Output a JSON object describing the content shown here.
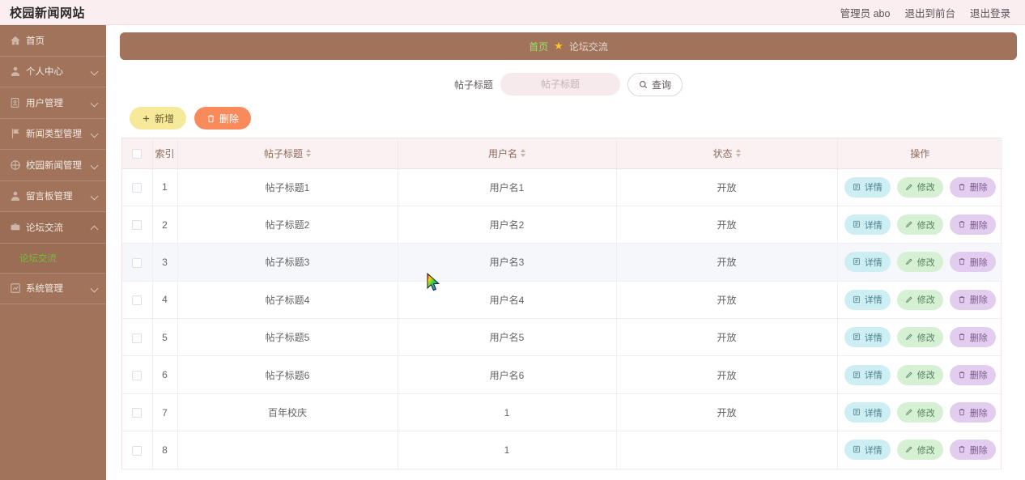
{
  "header": {
    "brand": "校园新闻网站",
    "admin_label": "管理员 abo",
    "exit_front_label": "退出到前台",
    "logout_label": "退出登录"
  },
  "sidebar": {
    "items": [
      {
        "label": "首页",
        "icon": "home-icon",
        "has_arrow": false,
        "expanded": false
      },
      {
        "label": "个人中心",
        "icon": "user-icon",
        "has_arrow": true,
        "expanded": false
      },
      {
        "label": "用户管理",
        "icon": "id-card-icon",
        "has_arrow": true,
        "expanded": false
      },
      {
        "label": "新闻类型管理",
        "icon": "flag-icon",
        "has_arrow": true,
        "expanded": false
      },
      {
        "label": "校园新闻管理",
        "icon": "compass-icon",
        "has_arrow": true,
        "expanded": false
      },
      {
        "label": "留言板管理",
        "icon": "person-icon",
        "has_arrow": true,
        "expanded": false
      },
      {
        "label": "论坛交流",
        "icon": "briefcase-icon",
        "has_arrow": true,
        "expanded": true
      },
      {
        "label": "系统管理",
        "icon": "chart-icon",
        "has_arrow": true,
        "expanded": false
      }
    ],
    "submenu": {
      "label": "论坛交流",
      "active_color": "#6fc038"
    }
  },
  "breadcrumb": {
    "home": "首页",
    "separator_icon": "star-icon",
    "current": "论坛交流"
  },
  "search": {
    "label": "帖子标题",
    "value": "",
    "placeholder": "帖子标题",
    "button_label": "查询",
    "button_icon": "search-icon"
  },
  "toolbar": {
    "add_label": "新增",
    "add_icon": "plus-icon",
    "delete_label": "删除",
    "delete_icon": "trash-icon"
  },
  "table": {
    "columns": [
      {
        "label": "",
        "sortable": false,
        "key": "checkbox"
      },
      {
        "label": "索引",
        "sortable": false,
        "key": "index"
      },
      {
        "label": "帖子标题",
        "sortable": true,
        "key": "title"
      },
      {
        "label": "用户名",
        "sortable": true,
        "key": "username"
      },
      {
        "label": "状态",
        "sortable": true,
        "key": "status"
      },
      {
        "label": "操作",
        "sortable": false,
        "key": "actions"
      }
    ],
    "row_actions": {
      "detail_label": "详情",
      "detail_icon": "document-icon",
      "edit_label": "修改",
      "edit_icon": "pencil-icon",
      "delete_label": "删除",
      "delete_icon": "trash-icon"
    },
    "rows": [
      {
        "index": "1",
        "title": "帖子标题1",
        "username": "用户名1",
        "status": "开放",
        "hovered": false
      },
      {
        "index": "2",
        "title": "帖子标题2",
        "username": "用户名2",
        "status": "开放",
        "hovered": false
      },
      {
        "index": "3",
        "title": "帖子标题3",
        "username": "用户名3",
        "status": "开放",
        "hovered": true
      },
      {
        "index": "4",
        "title": "帖子标题4",
        "username": "用户名4",
        "status": "开放",
        "hovered": false
      },
      {
        "index": "5",
        "title": "帖子标题5",
        "username": "用户名5",
        "status": "开放",
        "hovered": false
      },
      {
        "index": "6",
        "title": "帖子标题6",
        "username": "用户名6",
        "status": "开放",
        "hovered": false
      },
      {
        "index": "7",
        "title": "百年校庆",
        "username": "1",
        "status": "开放",
        "hovered": false
      },
      {
        "index": "8",
        "title": "",
        "username": "1",
        "status": "",
        "hovered": false
      }
    ]
  },
  "colors": {
    "sidebar": "#a0735a",
    "topbar": "#faeef1",
    "accent_green": "#6fc038",
    "table_header": "#faf1f2",
    "row_hover": "#f6f7fa"
  }
}
